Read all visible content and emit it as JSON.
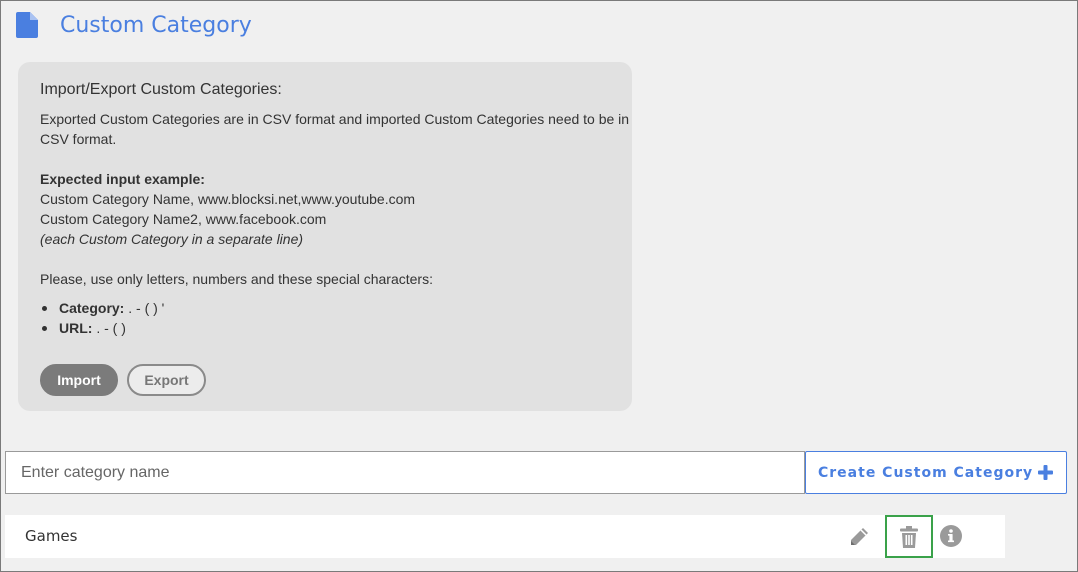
{
  "header": {
    "title": "Custom Category",
    "icon": "document-icon",
    "accent_color": "#4a7fe0"
  },
  "import_export": {
    "title": "Import/Export Custom Categories:",
    "description_line1": "Exported Custom Categories are in CSV format and imported Custom Categories need to be in",
    "description_line2": "CSV format.",
    "example_heading": "Expected input example:",
    "example_line1": "Custom Category Name, www.blocksi.net,www.youtube.com",
    "example_line2": "Custom Category Name2, www.facebook.com",
    "example_note": "(each Custom Category in a separate line)",
    "rules_intro": "Please, use only letters, numbers and these special characters:",
    "rules": [
      {
        "label": "Category:",
        "chars": " . - ( ) '"
      },
      {
        "label": "URL:",
        "chars": " . - ( )"
      }
    ],
    "import_label": "Import",
    "export_label": "Export"
  },
  "create": {
    "placeholder": "Enter category name",
    "button_label": "Create Custom Category",
    "button_icon": "plus-icon"
  },
  "categories": [
    {
      "name": "Games"
    }
  ],
  "row_actions": {
    "edit_icon": "pencil-icon",
    "delete_icon": "trash-icon",
    "info_icon": "info-icon",
    "selected_outline_color": "#3aa24a"
  }
}
